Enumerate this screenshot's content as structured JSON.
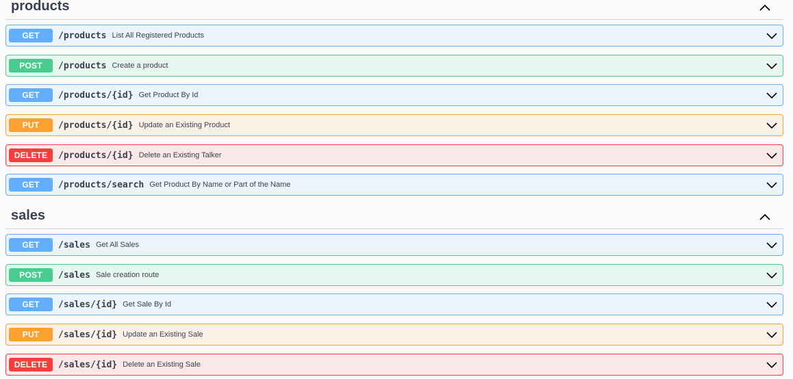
{
  "sections": [
    {
      "title": "products",
      "operations": [
        {
          "method": "GET",
          "path": "/products",
          "summary": "List All Registered Products"
        },
        {
          "method": "POST",
          "path": "/products",
          "summary": "Create a product"
        },
        {
          "method": "GET",
          "path": "/products/{id}",
          "summary": "Get Product By Id"
        },
        {
          "method": "PUT",
          "path": "/products/{id}",
          "summary": "Update an Existing Product"
        },
        {
          "method": "DELETE",
          "path": "/products/{id}",
          "summary": "Delete an Existing Talker"
        },
        {
          "method": "GET",
          "path": "/products/search",
          "summary": "Get Product By Name or Part of the Name"
        }
      ]
    },
    {
      "title": "sales",
      "operations": [
        {
          "method": "GET",
          "path": "/sales",
          "summary": "Get All Sales"
        },
        {
          "method": "POST",
          "path": "/sales",
          "summary": "Sale creation route"
        },
        {
          "method": "GET",
          "path": "/sales/{id}",
          "summary": "Get Sale By Id"
        },
        {
          "method": "PUT",
          "path": "/sales/{id}",
          "summary": "Update an Existing Sale"
        },
        {
          "method": "DELETE",
          "path": "/sales/{id}",
          "summary": "Delete an Existing Sale"
        }
      ]
    }
  ],
  "icons": {
    "section_toggle": "chevron-up-icon",
    "operation_toggle": "chevron-down-icon"
  },
  "colors": {
    "GET": "#61affe",
    "POST": "#49cc90",
    "PUT": "#fca130",
    "DELETE": "#f93e3e"
  }
}
